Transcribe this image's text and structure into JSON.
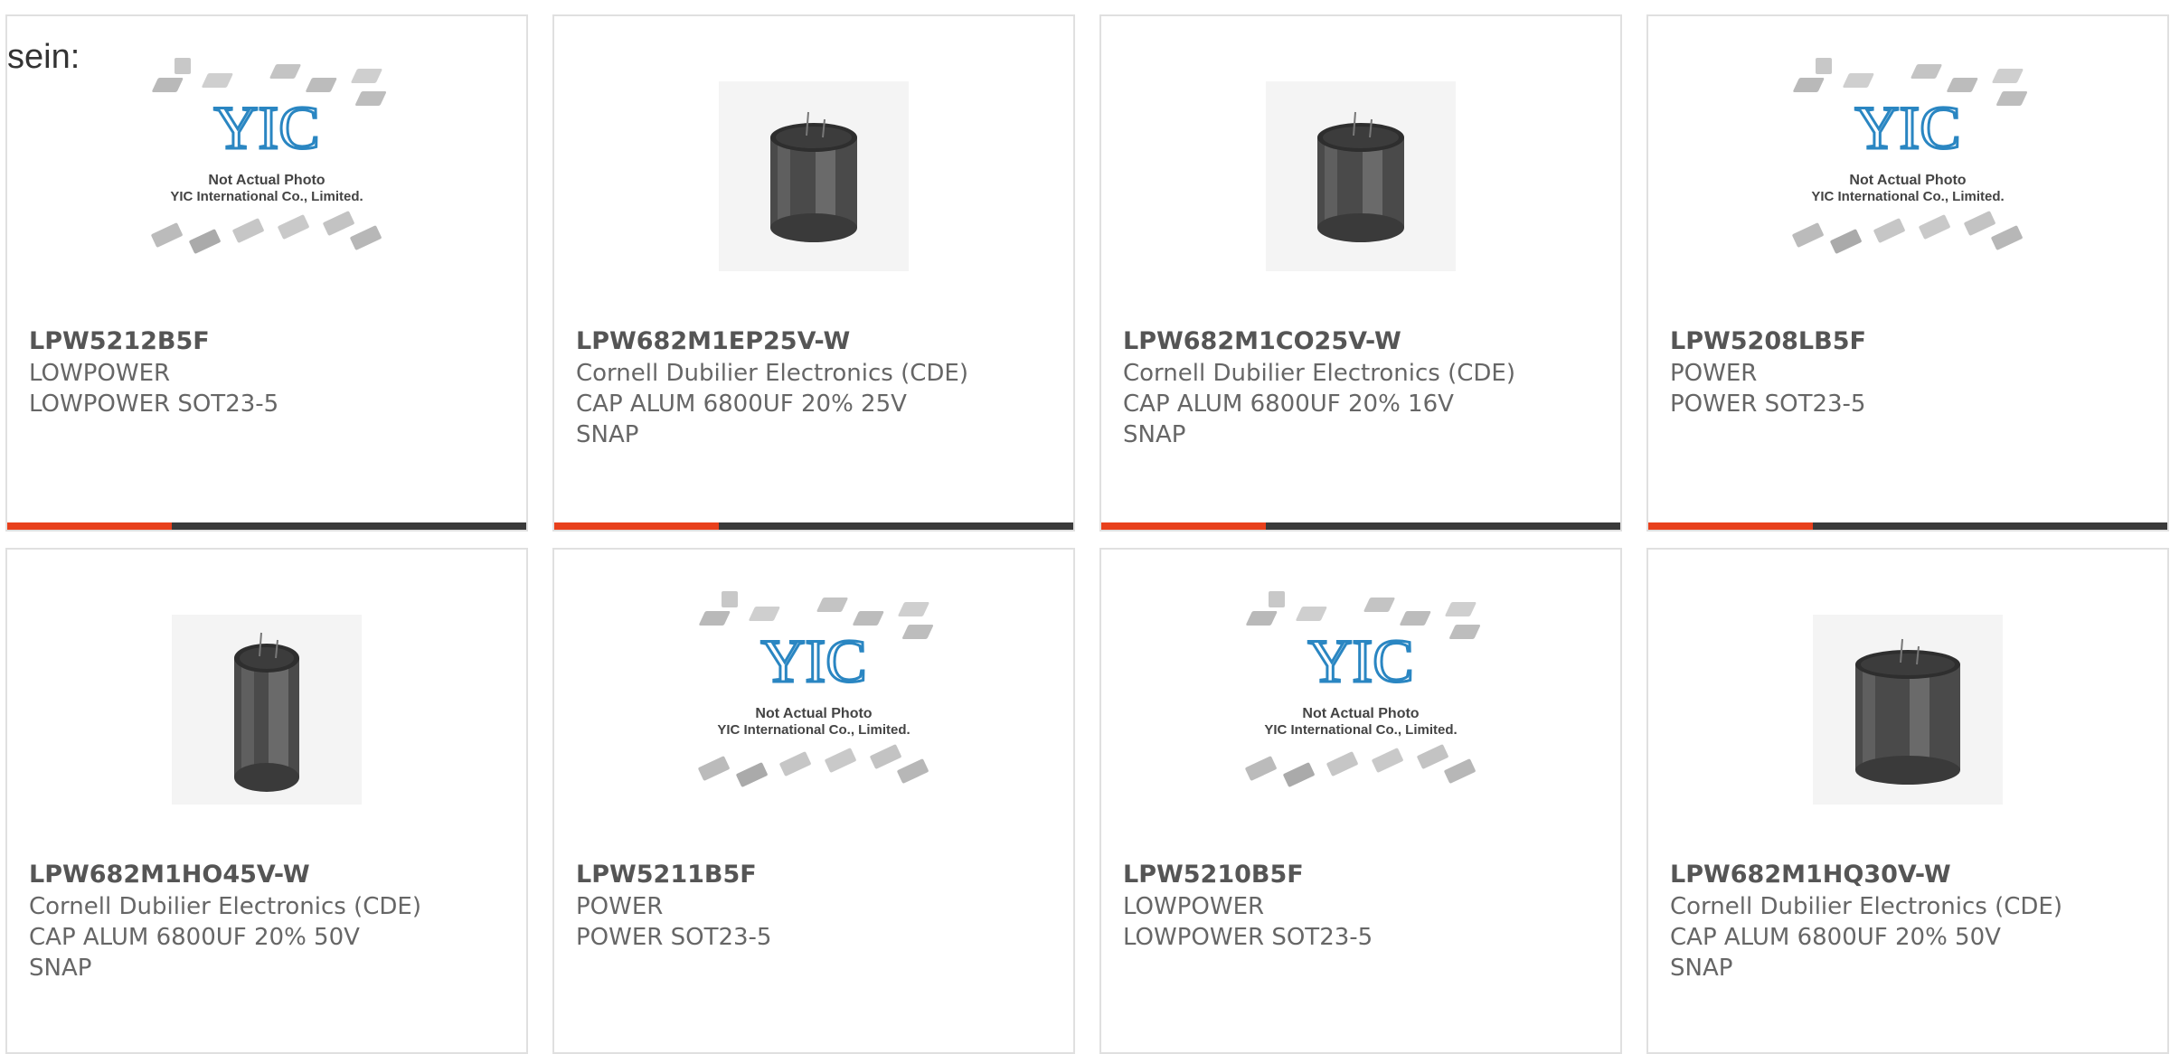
{
  "lead_text": "sein:",
  "accent_color": "#e8401c",
  "bar_color": "#3a3a3a",
  "placeholder": {
    "line1": "Not Actual Photo",
    "line2": "YIC International Co., Limited."
  },
  "products": [
    {
      "part_number": "LPW5212B5F",
      "manufacturer": "LOWPOWER",
      "description": "LOWPOWER SOT23-5",
      "extra": "",
      "image": "yic-placeholder-image"
    },
    {
      "part_number": "LPW682M1EP25V-W",
      "manufacturer": "Cornell Dubilier Electronics (CDE)",
      "description": "CAP ALUM 6800UF 20% 25V",
      "extra": "SNAP",
      "image": "capacitor-image"
    },
    {
      "part_number": "LPW682M1CO25V-W",
      "manufacturer": "Cornell Dubilier Electronics (CDE)",
      "description": "CAP ALUM 6800UF 20% 16V",
      "extra": "SNAP",
      "image": "capacitor-image"
    },
    {
      "part_number": "LPW5208LB5F",
      "manufacturer": "POWER",
      "description": "POWER SOT23-5",
      "extra": "",
      "image": "yic-placeholder-image"
    },
    {
      "part_number": "LPW682M1HO45V-W",
      "manufacturer": "Cornell Dubilier Electronics (CDE)",
      "description": "CAP ALUM 6800UF 20% 50V",
      "extra": "SNAP",
      "image": "capacitor-tall-image"
    },
    {
      "part_number": "LPW5211B5F",
      "manufacturer": "POWER",
      "description": "POWER SOT23-5",
      "extra": "",
      "image": "yic-placeholder-image"
    },
    {
      "part_number": "LPW5210B5F",
      "manufacturer": "LOWPOWER",
      "description": "LOWPOWER SOT23-5",
      "extra": "",
      "image": "yic-placeholder-image"
    },
    {
      "part_number": "LPW682M1HQ30V-W",
      "manufacturer": "Cornell Dubilier Electronics (CDE)",
      "description": "CAP ALUM 6800UF 20% 50V",
      "extra": "SNAP",
      "image": "capacitor-wide-image"
    }
  ]
}
